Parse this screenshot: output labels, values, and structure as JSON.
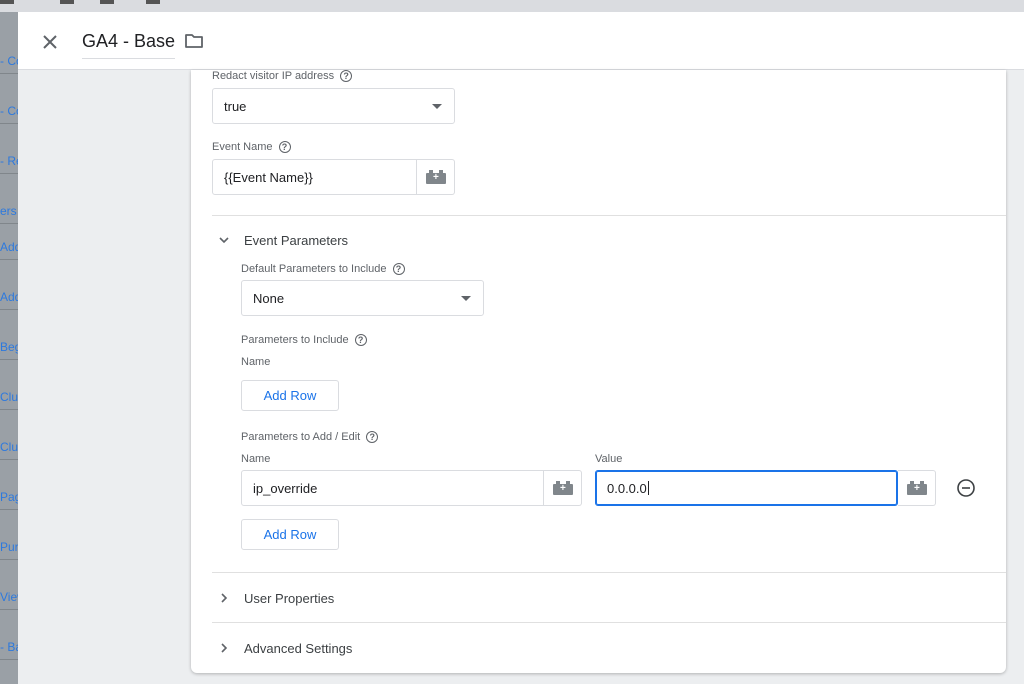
{
  "background": {
    "list_items": [
      "- Co",
      "- Co",
      "- Re",
      "ers",
      "Add",
      "Add",
      "Beg",
      "Club",
      "Club",
      "Pag",
      "Pur",
      "View",
      "- Ba"
    ]
  },
  "header": {
    "title": "GA4 - Base"
  },
  "form": {
    "redact_ip": {
      "label": "Redact visitor IP address",
      "value": "true"
    },
    "event_name": {
      "label": "Event Name",
      "value": "{{Event Name}}"
    },
    "event_parameters": {
      "title": "Event Parameters",
      "default_params": {
        "label": "Default Parameters to Include",
        "value": "None"
      },
      "params_include": {
        "label": "Parameters to Include",
        "name_label": "Name",
        "add_row": "Add Row"
      },
      "params_add_edit": {
        "label": "Parameters to Add / Edit",
        "name_label": "Name",
        "value_label": "Value",
        "row": {
          "name": "ip_override",
          "value": "0.0.0.0"
        },
        "add_row": "Add Row"
      }
    },
    "user_properties": {
      "title": "User Properties"
    },
    "advanced_settings": {
      "title": "Advanced Settings"
    }
  }
}
